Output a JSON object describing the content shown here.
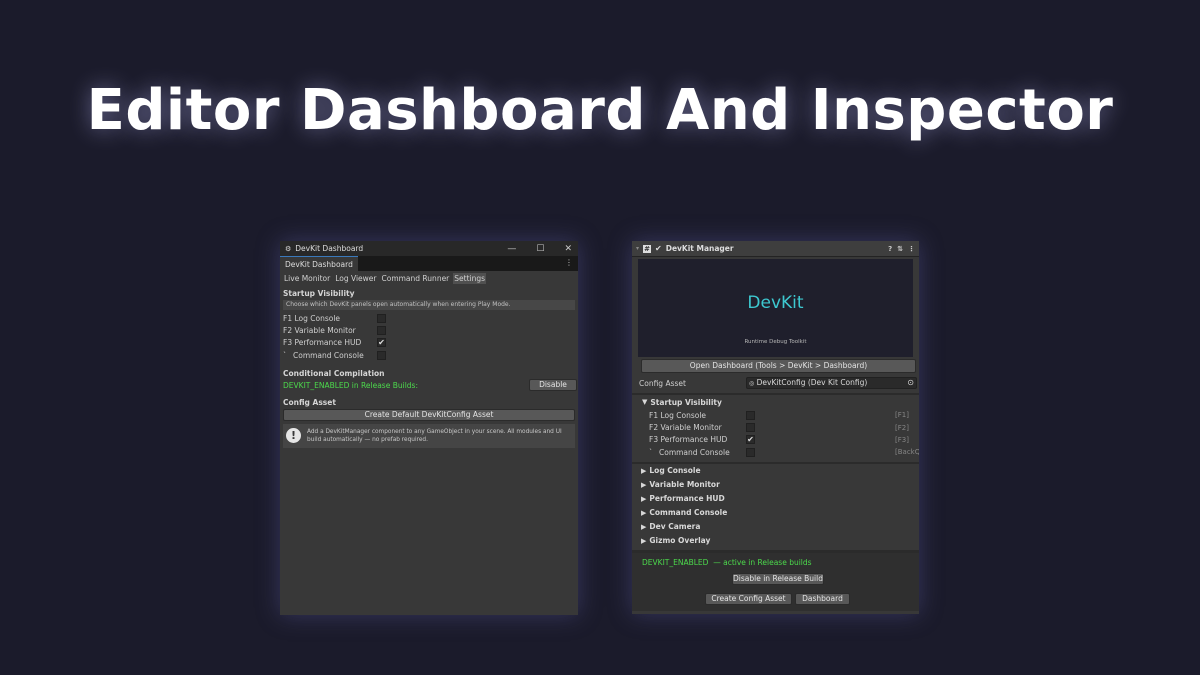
{
  "page_title": "Editor Dashboard And Inspector",
  "dashboard": {
    "window_title": "DevKit Dashboard",
    "window_icon": "devkit-logo-icon",
    "controls": {
      "minimize": "—",
      "maximize": "☐",
      "close": "✕"
    },
    "tab": "DevKit Dashboard",
    "kebab": "⋮",
    "subtabs": [
      "Live Monitor",
      "Log Viewer",
      "Command Runner",
      "Settings"
    ],
    "selected_subtab": "Settings",
    "startup_title": "Startup Visibility",
    "startup_help": "Choose which DevKit panels open automatically when entering Play Mode.",
    "panels": [
      {
        "key": "F1",
        "label": "Log Console",
        "checked": false
      },
      {
        "key": "F2",
        "label": "Variable Monitor",
        "checked": false
      },
      {
        "key": "F3",
        "label": "Performance HUD",
        "checked": true
      },
      {
        "key": "`",
        "label": "Command Console",
        "checked": false
      }
    ],
    "compilation_title": "Conditional Compilation",
    "compilation_status": "DEVKIT_ENABLED in Release Builds:",
    "compilation_button": "Disable",
    "config_title": "Config Asset",
    "create_button": "Create Default DevKitConfig Asset",
    "info_icon": "!",
    "info_line1": "Add a DevKitManager component to any GameObject in your scene. All modules and UI",
    "info_line2": "build automatically — no prefab required."
  },
  "inspector": {
    "header_title": "DevKit Manager",
    "header_icons": [
      "?",
      "⇅",
      "⋮"
    ],
    "preview_title": "DevKit",
    "preview_subtitle": "Runtime Debug Toolkit",
    "open_dashboard": "Open Dashboard  (Tools > DevKit > Dashboard)",
    "config_label": "Config Asset",
    "config_value": "DevKitConfig (Dev Kit Config)",
    "startup_title": "Startup Visibility",
    "panels": [
      {
        "key": "F1",
        "label": "Log Console",
        "checked": false,
        "shortcut": "[F1]"
      },
      {
        "key": "F2",
        "label": "Variable Monitor",
        "checked": false,
        "shortcut": "[F2]"
      },
      {
        "key": "F3",
        "label": "Performance HUD",
        "checked": true,
        "shortcut": "[F3]"
      },
      {
        "key": "`",
        "label": "Command Console",
        "checked": false,
        "shortcut": "[BackQ"
      }
    ],
    "foldouts": [
      "Log Console",
      "Variable Monitor",
      "Performance HUD",
      "Command Console",
      "Dev Camera",
      "Gizmo Overlay"
    ],
    "enabled_flag": "DEVKIT_ENABLED",
    "enabled_text": "— active in Release builds",
    "disable_button": "Disable in Release Build",
    "create_config": "Create Config Asset",
    "dashboard_button": "Dashboard"
  },
  "colors": {
    "accent_green": "#4cd94c",
    "devkit_teal": "#3dc8d0",
    "tab_accent": "#3a79bb"
  }
}
